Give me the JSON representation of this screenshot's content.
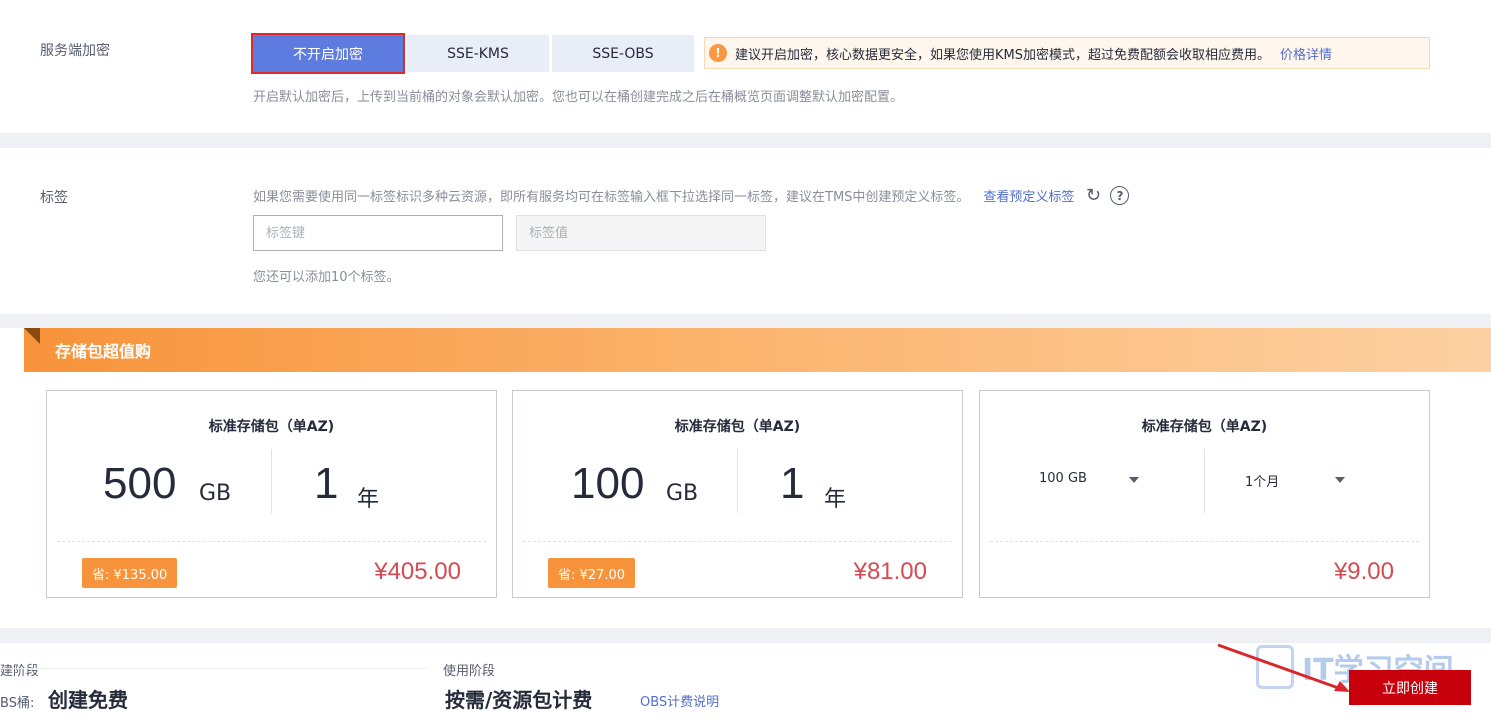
{
  "encryption": {
    "label": "服务端加密",
    "tabs": [
      "不开启加密",
      "SSE-KMS",
      "SSE-OBS"
    ],
    "active_tab": "不开启加密",
    "warning_text": "建议开启加密，核心数据更安全，如果您使用KMS加密模式，超过免费配额会收取相应费用。",
    "warning_link": "价格详情",
    "hint": "开启默认加密后，上传到当前桶的对象会默认加密。您也可以在桶创建完成之后在桶概览页面调整默认加密配置。"
  },
  "tags": {
    "label": "标签",
    "description": "如果您需要使用同一标签标识多种云资源，即所有服务均可在标签输入框下拉选择同一标签，建议在TMS中创建预定义标签。",
    "predefined_link": "查看预定义标签",
    "key_placeholder": "标签键",
    "value_placeholder": "标签值",
    "remaining_hint": "您还可以添加10个标签。"
  },
  "packages": {
    "banner_title": "存储包超值购",
    "cards": [
      {
        "title": "标准存储包（单AZ)",
        "size": "500",
        "size_unit": "GB",
        "duration": "1",
        "duration_unit": "年",
        "save": "省: ¥135.00",
        "price": "¥405.00"
      },
      {
        "title": "标准存储包（单AZ)",
        "size": "100",
        "size_unit": "GB",
        "duration": "1",
        "duration_unit": "年",
        "save": "省: ¥27.00",
        "price": "¥81.00"
      },
      {
        "title": "标准存储包（单AZ)",
        "size_select": "100 GB",
        "duration_select": "1个月",
        "price": "¥9.00"
      }
    ]
  },
  "footer": {
    "create_phase_label": "建阶段",
    "create_phase_prefix": "BS桶:",
    "create_phase_value": "创建免费",
    "usage_phase_label": "使用阶段",
    "usage_phase_value": "按需/资源包计费",
    "billing_link": "OBS计费说明",
    "create_button": "立即创建",
    "watermark": "IT学习空间"
  },
  "colors": {
    "primary_tab": "#5e7ce0",
    "create_button": "#c7000b",
    "price": "#d64a52",
    "banner": "#f7933a"
  }
}
